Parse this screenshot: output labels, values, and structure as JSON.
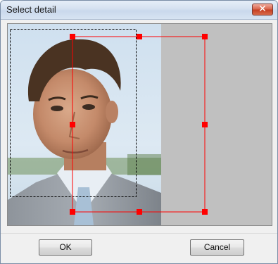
{
  "window": {
    "title": "Select detail",
    "close_glyph": "✕"
  },
  "editor": {
    "image_description_icon": "person-photo",
    "background_color": "#c0c0c0",
    "selection_color": "#ff0000"
  },
  "buttons": {
    "ok_label": "OK",
    "cancel_label": "Cancel"
  }
}
